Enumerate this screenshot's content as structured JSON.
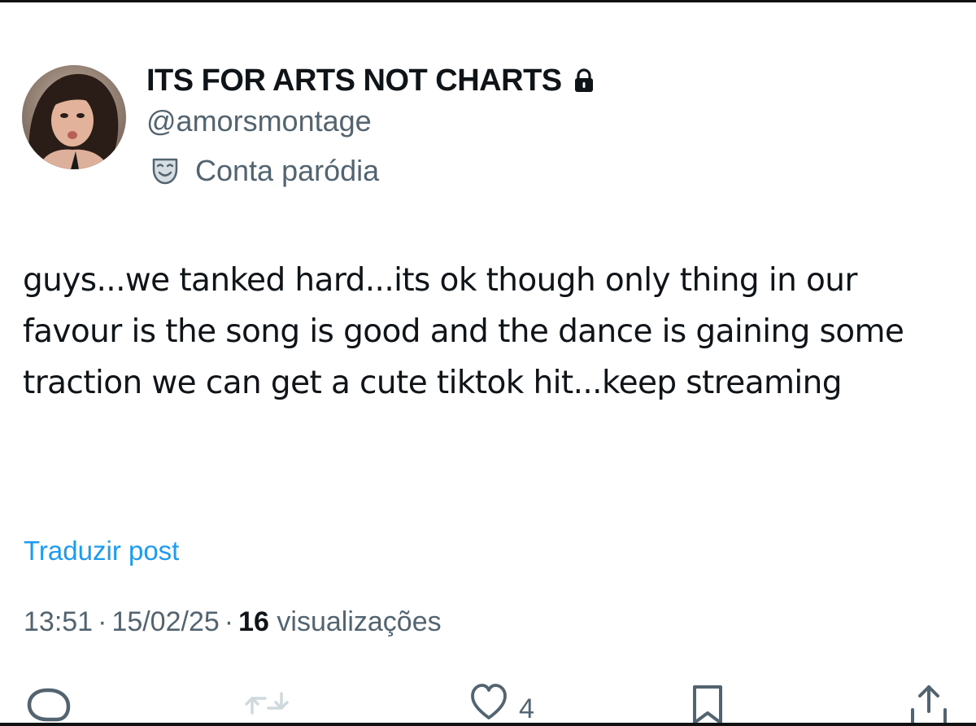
{
  "post": {
    "author": {
      "display_name": "ITS FOR ARTS NOT CHARTS",
      "handle": "@amorsmontage",
      "account_label": "Conta paródia",
      "locked": true
    },
    "text": "guys...we tanked hard...its ok though only thing in our favour is the song is good and the dance is gaining some traction we can get a cute tiktok hit...keep streaming",
    "translate_label": "Traduzir post",
    "meta": {
      "time": "13:51",
      "date": "15/02/25",
      "separator": "·",
      "views_count": "16",
      "views_label": "visualizações"
    },
    "actions": {
      "reply": {
        "icon": "reply-icon"
      },
      "repost": {
        "icon": "repost-icon"
      },
      "like": {
        "icon": "heart-icon",
        "count": "4"
      },
      "bookmark": {
        "icon": "bookmark-icon"
      },
      "share": {
        "icon": "share-icon"
      }
    }
  },
  "colors": {
    "text_primary": "#0f1419",
    "text_secondary": "#536471",
    "link": "#1d9bf0",
    "border": "#111111"
  }
}
